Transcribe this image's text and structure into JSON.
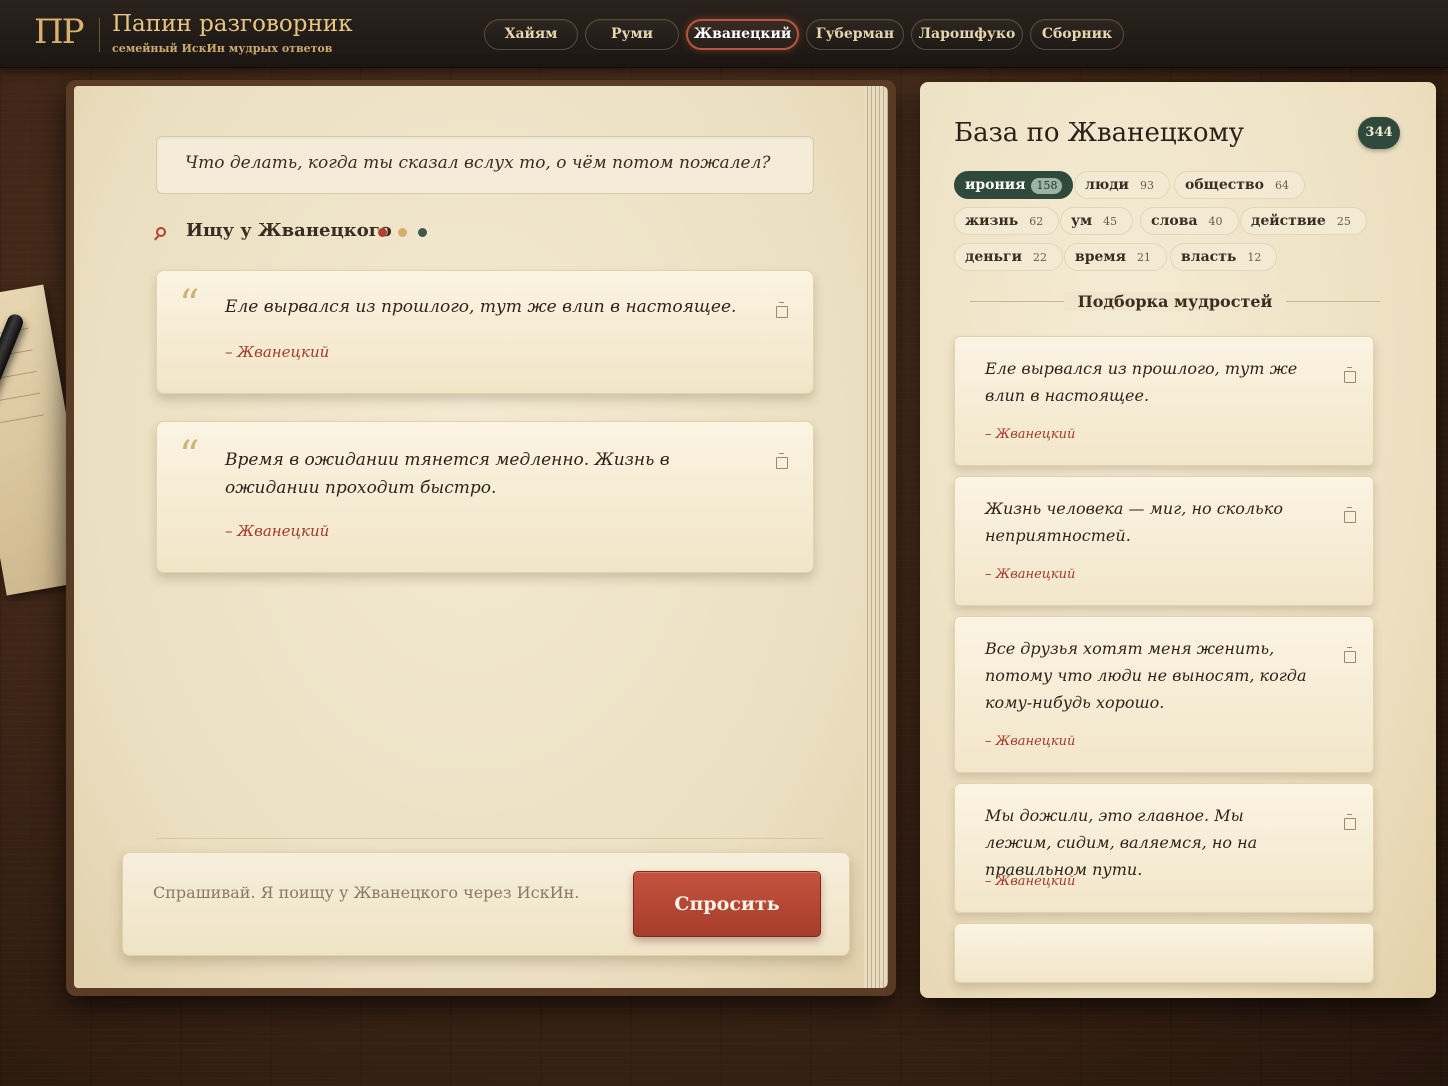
{
  "brand": {
    "mark": "ПР",
    "title": "Папин разговорник",
    "subtitle": "семейный ИскИн мудрых ответов"
  },
  "nav": {
    "tabs": [
      {
        "label": "Хайям",
        "active": false
      },
      {
        "label": "Руми",
        "active": false
      },
      {
        "label": "Жванецкий",
        "active": true
      },
      {
        "label": "Губерман",
        "active": false
      },
      {
        "label": "Ларошфуко",
        "active": false
      },
      {
        "label": "Сборник",
        "active": false
      }
    ]
  },
  "conversation": {
    "question": "Что делать, когда ты сказал вслух то, о чём потом пожалел?",
    "search_status": "Ищу у Жванецкого",
    "status_dot_colors": [
      "#b4412f",
      "#d4b06a",
      "#3e5a48"
    ],
    "quote_mark": "“",
    "answers": [
      {
        "text": "Еле вырвался из прошлого, тут же влип в настоящее.",
        "author": "– Жванецкий"
      },
      {
        "text": "Время в ожидании тянется медленно. Жизнь в ожидании проходит быстро.",
        "author": "– Жванецкий"
      }
    ]
  },
  "ask": {
    "placeholder": "Спрашивай. Я поищу у Жванецкого через ИскИн.",
    "button_label": "Спросить"
  },
  "sidebar": {
    "title": "База по Жванецкому",
    "total_count": "344",
    "tags": [
      {
        "label": "ирония",
        "count": "158",
        "active": true
      },
      {
        "label": "люди",
        "count": "93",
        "active": false
      },
      {
        "label": "общество",
        "count": "64",
        "active": false
      },
      {
        "label": "жизнь",
        "count": "62",
        "active": false
      },
      {
        "label": "ум",
        "count": "45",
        "active": false
      },
      {
        "label": "слова",
        "count": "40",
        "active": false
      },
      {
        "label": "действие",
        "count": "25",
        "active": false
      },
      {
        "label": "деньги",
        "count": "22",
        "active": false
      },
      {
        "label": "время",
        "count": "21",
        "active": false
      },
      {
        "label": "власть",
        "count": "12",
        "active": false
      }
    ],
    "section_label": "Подборка мудростей",
    "quotes": [
      {
        "text": "Еле вырвался из прошлого, тут же влип в настоящее.",
        "author": "– Жванецкий"
      },
      {
        "text": "Жизнь человека — миг, но сколько неприятностей.",
        "author": "– Жванецкий"
      },
      {
        "text": "Все друзья хотят меня женить, потому что люди не выносят, когда кому-нибудь хорошо.",
        "author": "– Жванецкий"
      },
      {
        "text": "Мы дожили, это главное. Мы лежим, сидим, валяемся, но на правильном пути.",
        "author": "– Жванецкий"
      }
    ]
  },
  "colors": {
    "accent_red": "#b4412f",
    "accent_green": "#2f4a3c",
    "gold": "#d7b26c",
    "paper": "#f3ead3"
  }
}
